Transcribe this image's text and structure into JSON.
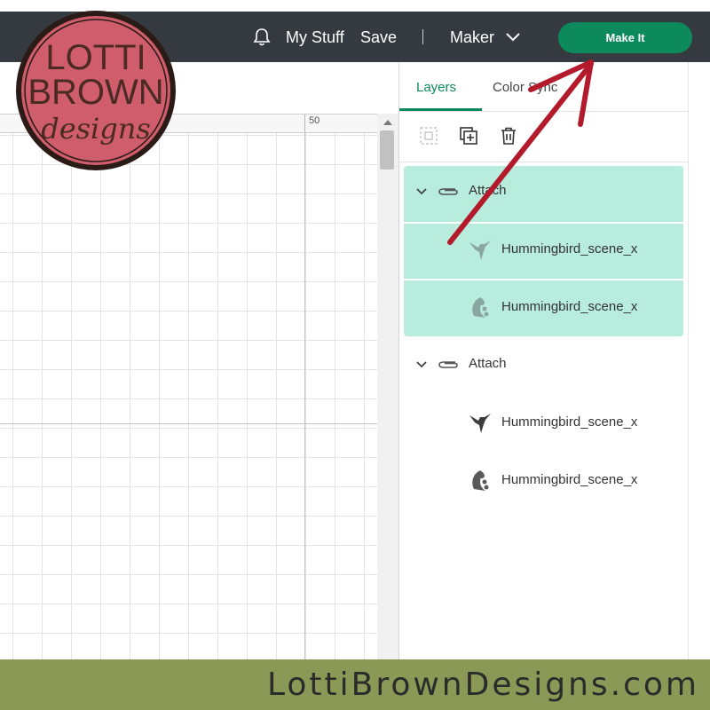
{
  "header": {
    "my_stuff": "My Stuff",
    "save": "Save",
    "separator": "|",
    "machine": "Maker",
    "make_it": "Make It"
  },
  "canvas": {
    "ruler_mark": "50"
  },
  "panel": {
    "tabs": [
      {
        "label": "Layers",
        "active": true
      },
      {
        "label": "Color Sync",
        "active": false
      }
    ],
    "groups": [
      {
        "label": "Attach",
        "selected": true,
        "layers": [
          {
            "label": "Hummingbird_scene_x",
            "thumb": "hummingbird-icon"
          },
          {
            "label": "Hummingbird_scene_x",
            "thumb": "flower-icon"
          }
        ]
      },
      {
        "label": "Attach",
        "selected": false,
        "layers": [
          {
            "label": "Hummingbird_scene_x",
            "thumb": "hummingbird-icon"
          },
          {
            "label": "Hummingbird_scene_x",
            "thumb": "flower-icon"
          }
        ]
      }
    ]
  },
  "logo": {
    "line1": "LOTTI",
    "line2": "BROWN",
    "line3": "designs"
  },
  "footer": {
    "text": "LottiBrownDesigns.com"
  },
  "colors": {
    "topbar": "#353a41",
    "accent": "#0d8a5c",
    "selection": "#b8ecdc",
    "footer": "#8a9a56",
    "logo_fill": "#cf5d6c",
    "logo_text": "#4a2a22",
    "arrow": "#b31b2c"
  }
}
